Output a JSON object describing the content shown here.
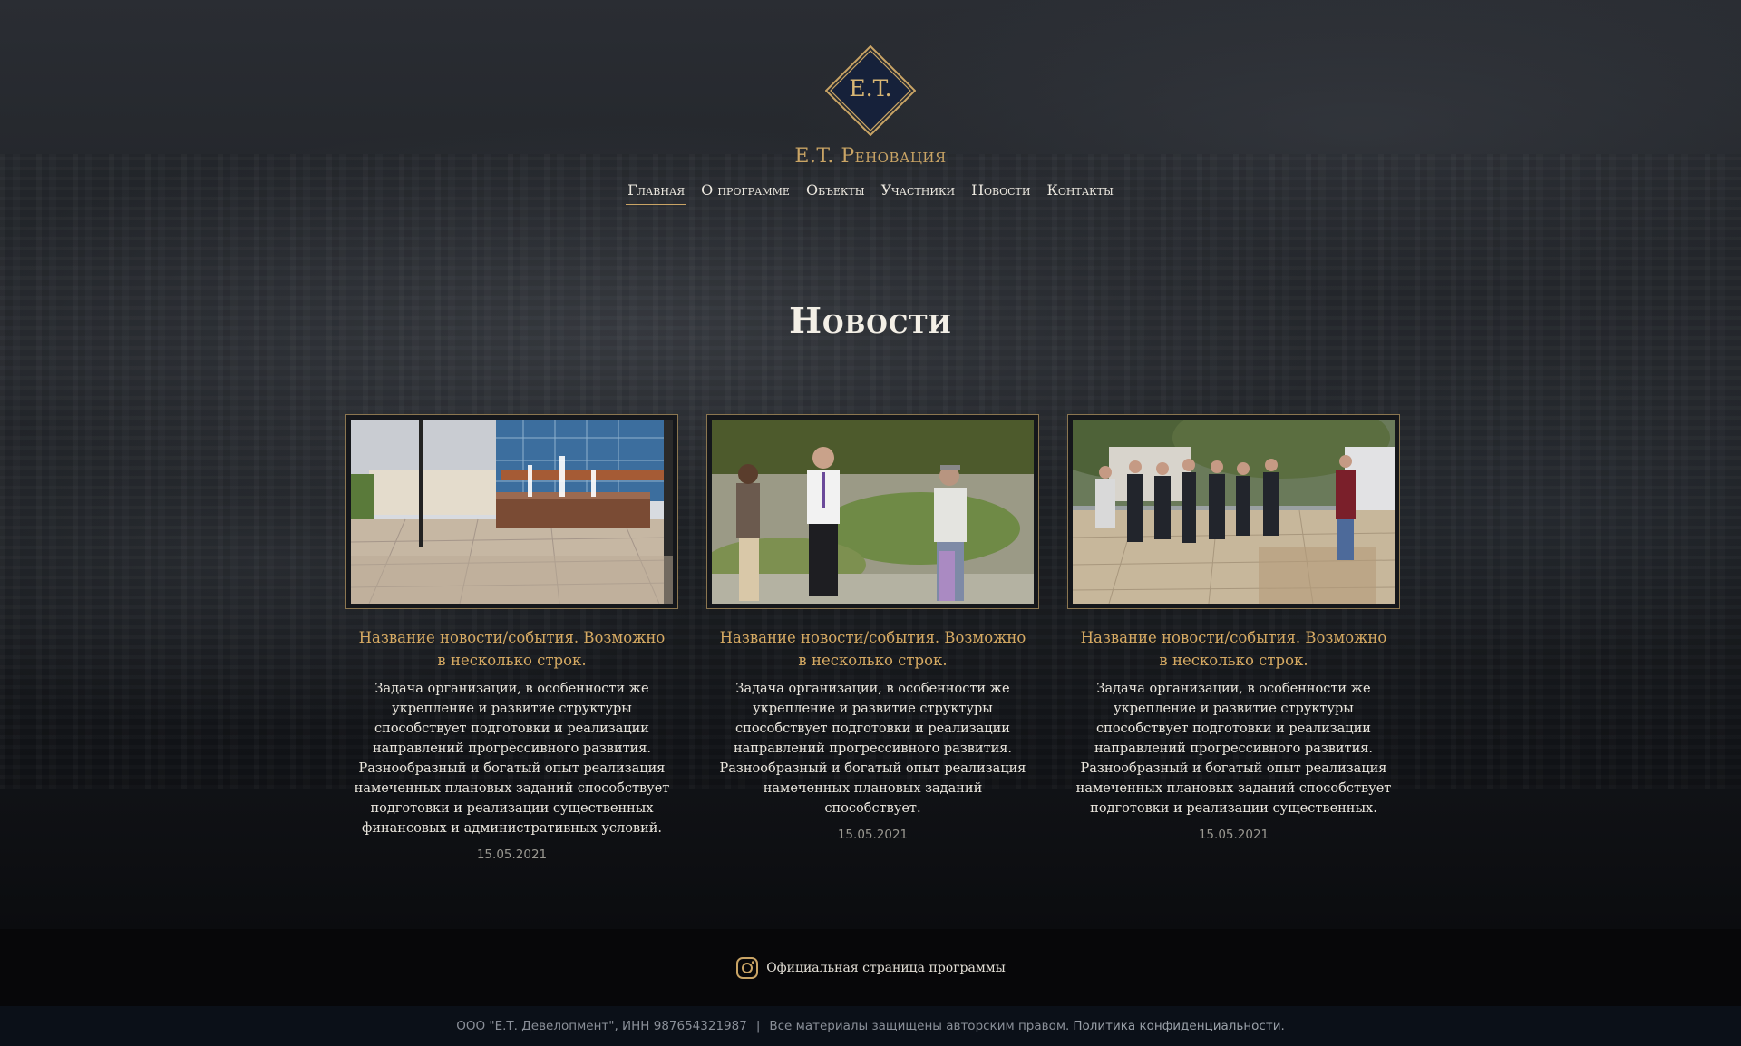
{
  "brand": {
    "monogram": "E.T.",
    "name": "E.T. Реновация",
    "colors": {
      "gold": "#c9a465",
      "navy": "#16213a"
    }
  },
  "nav": {
    "items": [
      {
        "label": "Главная",
        "active": true
      },
      {
        "label": "О программе"
      },
      {
        "label": "Объекты"
      },
      {
        "label": "Участники"
      },
      {
        "label": "Новости"
      },
      {
        "label": "Контакты"
      }
    ]
  },
  "section": {
    "title": "Новости"
  },
  "news": [
    {
      "title": "Название новости/события. Возможно в несколько строк.",
      "text": "Задача организации, в особенности же укрепление и развитие структуры способствует подготовки и реализации направлений прогрессивного развития. Разнообразный и богатый опыт реализация намеченных плановых заданий способствует подготовки и реализации существенных финансовых и административных условий.",
      "date": "15.05.2021",
      "image": "city-square-fountain"
    },
    {
      "title": "Название новости/события. Возможно в несколько строк.",
      "text": "Задача организации, в особенности же укрепление и развитие структуры способствует подготовки и реализации направлений прогрессивного развития. Разнообразный и богатый опыт реализация намеченных плановых заданий способствует.",
      "date": "15.05.2021",
      "image": "people-in-garden"
    },
    {
      "title": "Название новости/события. Возможно в несколько строк.",
      "text": "Задача организации, в особенности же укрепление и развитие структуры способствует подготовки и реализации направлений прогрессивного развития. Разнообразный и богатый опыт реализация намеченных плановых заданий способствует подготовки и реализации существенных.",
      "date": "15.05.2021",
      "image": "officials-group-meeting"
    }
  ],
  "social": {
    "icon": "instagram-icon",
    "label": "Официальная страница программы"
  },
  "footer": {
    "company": "ООО \"Е.Т. Девелопмент\", ИНН 987654321987",
    "separator": "|",
    "rights": "Все материалы защищены авторским правом.",
    "privacy_link": "Политика конфиденциальности."
  }
}
